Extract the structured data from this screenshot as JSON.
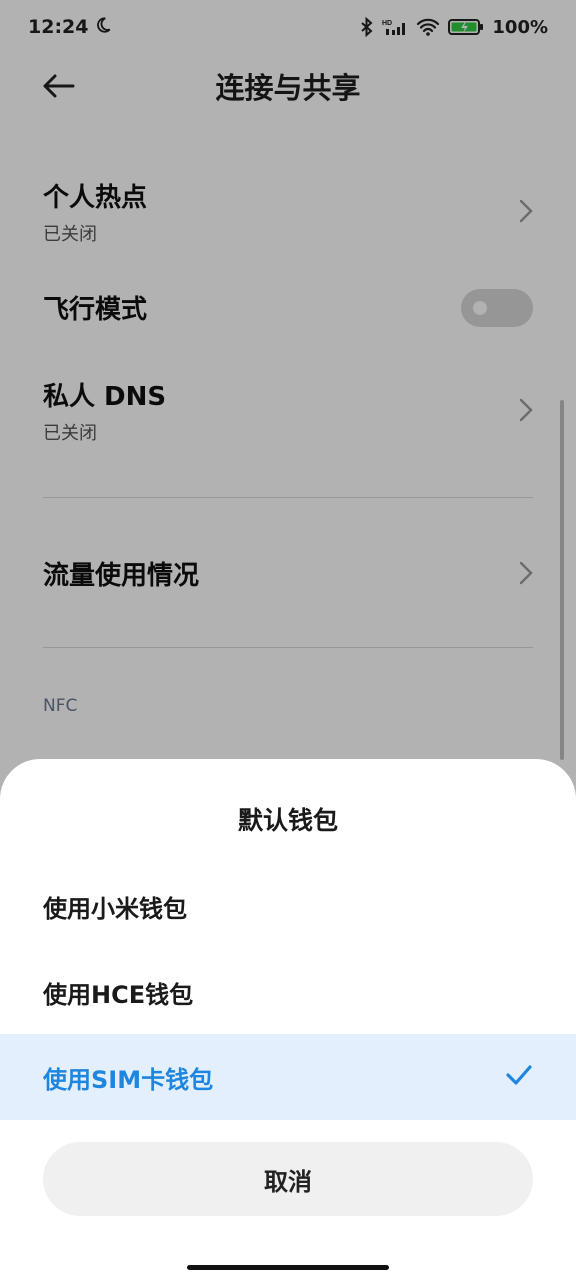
{
  "status": {
    "time": "12:24",
    "battery": "100%"
  },
  "header": {
    "title": "连接与共享"
  },
  "settings": {
    "hotspot": {
      "title": "个人热点",
      "sub": "已关闭"
    },
    "airplane": {
      "title": "飞行模式",
      "on": false
    },
    "dns": {
      "title": "私人 DNS",
      "sub": "已关闭"
    },
    "data_usage": {
      "title": "流量使用情况"
    },
    "nfc_section": "NFC"
  },
  "sheet": {
    "title": "默认钱包",
    "options": [
      {
        "label": "使用小米钱包",
        "selected": false
      },
      {
        "label": "使用HCE钱包",
        "selected": false
      },
      {
        "label": "使用SIM卡钱包",
        "selected": true
      }
    ],
    "cancel": "取消"
  },
  "colors": {
    "accent": "#1f86df",
    "selected_bg": "#e3effd"
  }
}
